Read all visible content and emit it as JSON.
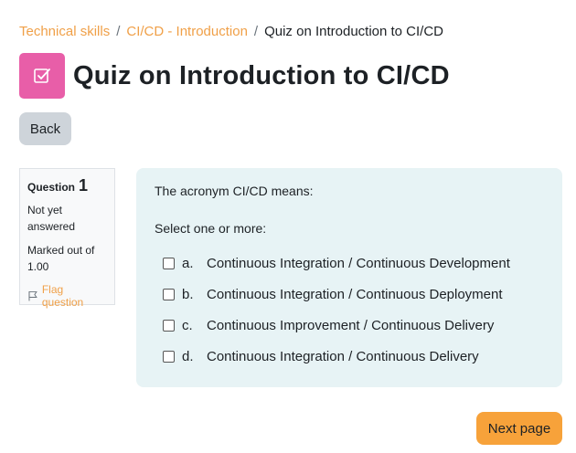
{
  "breadcrumb": {
    "items": [
      "Technical skills",
      "CI/CD - Introduction"
    ],
    "separator": "/",
    "current": "Quiz on Introduction to CI/CD"
  },
  "header": {
    "icon": "quiz-checkbox-icon",
    "title": "Quiz on Introduction to CI/CD"
  },
  "nav": {
    "back_label": "Back",
    "next_label": "Next page"
  },
  "question_info": {
    "question_label": "Question",
    "number": "1",
    "state": "Not yet answered",
    "grade": "Marked out of 1.00",
    "flag_label": "Flag question"
  },
  "question": {
    "text": "The acronym CI/CD  means:",
    "prompt": "Select one or more:",
    "answers": [
      {
        "letter": "a.",
        "text": "Continuous Integration / Continuous Development",
        "checked": false
      },
      {
        "letter": "b.",
        "text": "Continuous Integration / Continuous Deployment",
        "checked": false
      },
      {
        "letter": "c.",
        "text": "Continuous Improvement / Continuous Delivery",
        "checked": false
      },
      {
        "letter": "d.",
        "text": "Continuous Integration / Continuous Delivery",
        "checked": false
      }
    ]
  },
  "colors": {
    "link": "#f0a048",
    "quiz_icon_bg": "#e85ea8",
    "question_bg": "#e7f3f5",
    "next_button": "#f7a23a",
    "back_button": "#ced4da"
  }
}
